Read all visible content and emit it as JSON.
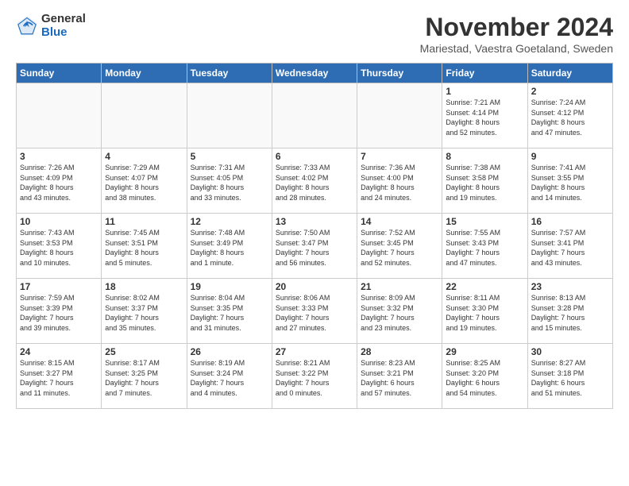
{
  "logo": {
    "general": "General",
    "blue": "Blue"
  },
  "title": "November 2024",
  "subtitle": "Mariestad, Vaestra Goetaland, Sweden",
  "headers": [
    "Sunday",
    "Monday",
    "Tuesday",
    "Wednesday",
    "Thursday",
    "Friday",
    "Saturday"
  ],
  "weeks": [
    [
      {
        "day": "",
        "info": ""
      },
      {
        "day": "",
        "info": ""
      },
      {
        "day": "",
        "info": ""
      },
      {
        "day": "",
        "info": ""
      },
      {
        "day": "",
        "info": ""
      },
      {
        "day": "1",
        "info": "Sunrise: 7:21 AM\nSunset: 4:14 PM\nDaylight: 8 hours\nand 52 minutes."
      },
      {
        "day": "2",
        "info": "Sunrise: 7:24 AM\nSunset: 4:12 PM\nDaylight: 8 hours\nand 47 minutes."
      }
    ],
    [
      {
        "day": "3",
        "info": "Sunrise: 7:26 AM\nSunset: 4:09 PM\nDaylight: 8 hours\nand 43 minutes."
      },
      {
        "day": "4",
        "info": "Sunrise: 7:29 AM\nSunset: 4:07 PM\nDaylight: 8 hours\nand 38 minutes."
      },
      {
        "day": "5",
        "info": "Sunrise: 7:31 AM\nSunset: 4:05 PM\nDaylight: 8 hours\nand 33 minutes."
      },
      {
        "day": "6",
        "info": "Sunrise: 7:33 AM\nSunset: 4:02 PM\nDaylight: 8 hours\nand 28 minutes."
      },
      {
        "day": "7",
        "info": "Sunrise: 7:36 AM\nSunset: 4:00 PM\nDaylight: 8 hours\nand 24 minutes."
      },
      {
        "day": "8",
        "info": "Sunrise: 7:38 AM\nSunset: 3:58 PM\nDaylight: 8 hours\nand 19 minutes."
      },
      {
        "day": "9",
        "info": "Sunrise: 7:41 AM\nSunset: 3:55 PM\nDaylight: 8 hours\nand 14 minutes."
      }
    ],
    [
      {
        "day": "10",
        "info": "Sunrise: 7:43 AM\nSunset: 3:53 PM\nDaylight: 8 hours\nand 10 minutes."
      },
      {
        "day": "11",
        "info": "Sunrise: 7:45 AM\nSunset: 3:51 PM\nDaylight: 8 hours\nand 5 minutes."
      },
      {
        "day": "12",
        "info": "Sunrise: 7:48 AM\nSunset: 3:49 PM\nDaylight: 8 hours\nand 1 minute."
      },
      {
        "day": "13",
        "info": "Sunrise: 7:50 AM\nSunset: 3:47 PM\nDaylight: 7 hours\nand 56 minutes."
      },
      {
        "day": "14",
        "info": "Sunrise: 7:52 AM\nSunset: 3:45 PM\nDaylight: 7 hours\nand 52 minutes."
      },
      {
        "day": "15",
        "info": "Sunrise: 7:55 AM\nSunset: 3:43 PM\nDaylight: 7 hours\nand 47 minutes."
      },
      {
        "day": "16",
        "info": "Sunrise: 7:57 AM\nSunset: 3:41 PM\nDaylight: 7 hours\nand 43 minutes."
      }
    ],
    [
      {
        "day": "17",
        "info": "Sunrise: 7:59 AM\nSunset: 3:39 PM\nDaylight: 7 hours\nand 39 minutes."
      },
      {
        "day": "18",
        "info": "Sunrise: 8:02 AM\nSunset: 3:37 PM\nDaylight: 7 hours\nand 35 minutes."
      },
      {
        "day": "19",
        "info": "Sunrise: 8:04 AM\nSunset: 3:35 PM\nDaylight: 7 hours\nand 31 minutes."
      },
      {
        "day": "20",
        "info": "Sunrise: 8:06 AM\nSunset: 3:33 PM\nDaylight: 7 hours\nand 27 minutes."
      },
      {
        "day": "21",
        "info": "Sunrise: 8:09 AM\nSunset: 3:32 PM\nDaylight: 7 hours\nand 23 minutes."
      },
      {
        "day": "22",
        "info": "Sunrise: 8:11 AM\nSunset: 3:30 PM\nDaylight: 7 hours\nand 19 minutes."
      },
      {
        "day": "23",
        "info": "Sunrise: 8:13 AM\nSunset: 3:28 PM\nDaylight: 7 hours\nand 15 minutes."
      }
    ],
    [
      {
        "day": "24",
        "info": "Sunrise: 8:15 AM\nSunset: 3:27 PM\nDaylight: 7 hours\nand 11 minutes."
      },
      {
        "day": "25",
        "info": "Sunrise: 8:17 AM\nSunset: 3:25 PM\nDaylight: 7 hours\nand 7 minutes."
      },
      {
        "day": "26",
        "info": "Sunrise: 8:19 AM\nSunset: 3:24 PM\nDaylight: 7 hours\nand 4 minutes."
      },
      {
        "day": "27",
        "info": "Sunrise: 8:21 AM\nSunset: 3:22 PM\nDaylight: 7 hours\nand 0 minutes."
      },
      {
        "day": "28",
        "info": "Sunrise: 8:23 AM\nSunset: 3:21 PM\nDaylight: 6 hours\nand 57 minutes."
      },
      {
        "day": "29",
        "info": "Sunrise: 8:25 AM\nSunset: 3:20 PM\nDaylight: 6 hours\nand 54 minutes."
      },
      {
        "day": "30",
        "info": "Sunrise: 8:27 AM\nSunset: 3:18 PM\nDaylight: 6 hours\nand 51 minutes."
      }
    ]
  ]
}
